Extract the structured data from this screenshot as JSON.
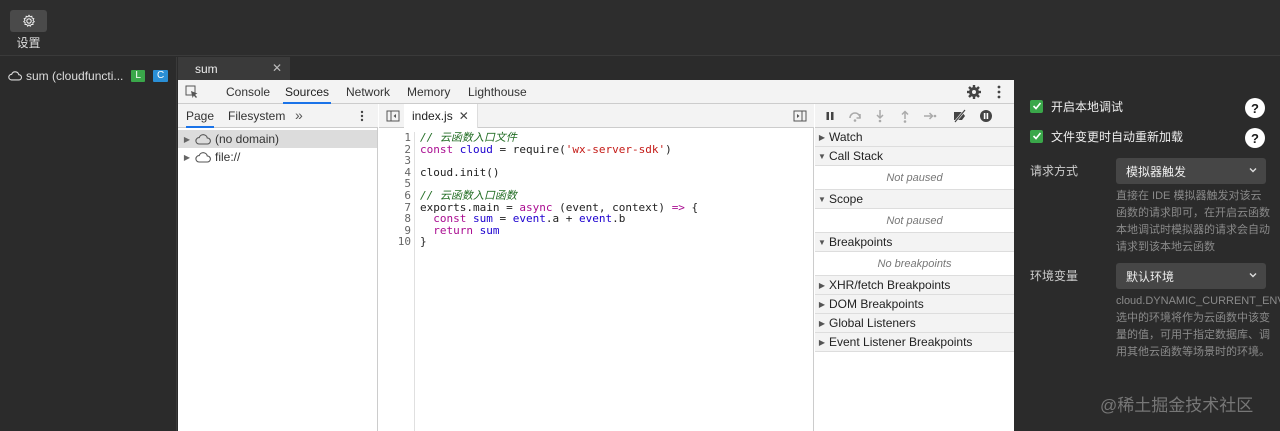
{
  "topbar": {
    "settings_label": "设置"
  },
  "sidebar": {
    "function_name": "sum (cloudfuncti...",
    "badge_l": "L",
    "badge_c": "C"
  },
  "file_tab": {
    "label": "sum",
    "close": "✕"
  },
  "devtools": {
    "tabs": [
      "Console",
      "Sources",
      "Network",
      "Memory",
      "Lighthouse"
    ],
    "active_tab": "Sources",
    "navigator": {
      "tabs": [
        "Page",
        "Filesystem"
      ],
      "more": "»",
      "tree": [
        "(no domain)",
        "file://"
      ]
    },
    "editor": {
      "file": "index.js",
      "close": "✕",
      "line_numbers": [
        "1",
        "2",
        "3",
        "4",
        "5",
        "6",
        "7",
        "8",
        "9",
        "10"
      ]
    },
    "debugger": {
      "sections": {
        "watch": "Watch",
        "call_stack": "Call Stack",
        "call_stack_body": "Not paused",
        "scope": "Scope",
        "scope_body": "Not paused",
        "breakpoints": "Breakpoints",
        "breakpoints_body": "No breakpoints",
        "xhr": "XHR/fetch Breakpoints",
        "dom": "DOM Breakpoints",
        "global": "Global Listeners",
        "event": "Event Listener Breakpoints"
      }
    }
  },
  "right_panel": {
    "enable_local_debug": "开启本地调试",
    "auto_reload": "文件变更时自动重新加载",
    "help": "?",
    "request_mode_label": "请求方式",
    "request_mode_value": "模拟器触发",
    "request_mode_desc": "直接在 IDE 模拟器触发对该云函数的请求即可，在开启云函数本地调试时模拟器的请求会自动请求到该本地云函数",
    "env_label": "环境变量",
    "env_value": "默认环境",
    "env_desc": "cloud.DYNAMIC_CURRENT_ENV, 选中的环境将作为云函数中该变量的值，可用于指定数据库、调用其他云函数等场景时的环境。"
  },
  "watermark": "@稀土掘金技术社区",
  "colors": {
    "accent_blue": "#1a73e8",
    "check_green": "#3aa74a"
  }
}
